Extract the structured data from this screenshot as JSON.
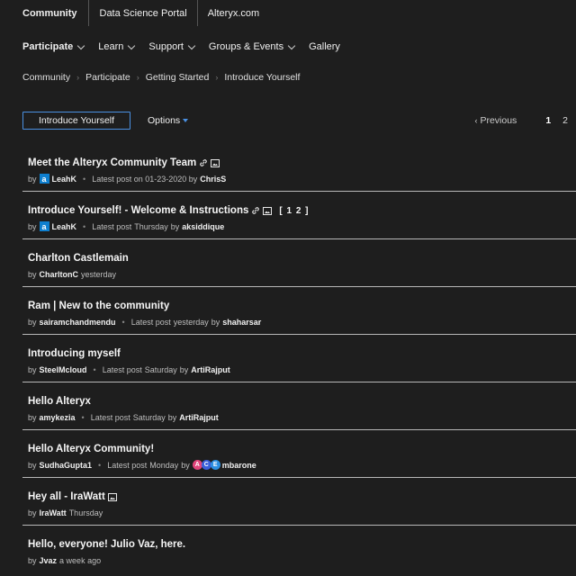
{
  "sites": [
    "Community",
    "Data Science Portal",
    "Alteryx.com"
  ],
  "nav": [
    "Participate",
    "Learn",
    "Support",
    "Groups & Events",
    "Gallery"
  ],
  "breadcrumb": [
    "Community",
    "Participate",
    "Getting Started",
    "Introduce Yourself"
  ],
  "toolbar": {
    "intro_button": "Introduce Yourself",
    "options": "Options"
  },
  "pager": {
    "previous": "Previous",
    "pages": [
      "1",
      "2"
    ],
    "current": "1"
  },
  "colors": {
    "accent": "#4a90e2",
    "background": "#1e1e1e",
    "divider": "#b8b8b8"
  },
  "topics": [
    {
      "title": "Meet the Alteryx Community Team",
      "by": "by",
      "author": "LeahK",
      "latest_prefix": "Latest post on 01-23-2020 by",
      "latest_user": "ChrisS",
      "icons": [
        "link-icon",
        "image-icon"
      ]
    },
    {
      "title": "Introduce Yourself! - Welcome & Instructions",
      "pages_ref": "[ 1 2 ]",
      "by": "by",
      "author": "LeahK",
      "latest_prefix": "Latest post",
      "latest_when": "Thursday",
      "latest_by": "by",
      "latest_user": "aksiddique",
      "icons": [
        "link-icon",
        "image-icon"
      ]
    },
    {
      "title": "Charlton Castlemain",
      "by": "by",
      "author": "CharltonC",
      "when": "yesterday"
    },
    {
      "title": "Ram | New to the community",
      "by": "by",
      "author": "sairamchandmendu",
      "latest_prefix": "Latest post",
      "latest_when": "yesterday",
      "latest_by": "by",
      "latest_user": "shaharsar"
    },
    {
      "title": "Introducing myself",
      "by": "by",
      "author": "SteelMcloud",
      "latest_prefix": "Latest post",
      "latest_when": "Saturday",
      "latest_by": "by",
      "latest_user": "ArtiRajput"
    },
    {
      "title": "Hello Alteryx",
      "by": "by",
      "author": "amykezia",
      "latest_prefix": "Latest post",
      "latest_when": "Saturday",
      "latest_by": "by",
      "latest_user": "ArtiRajput"
    },
    {
      "title": "Hello Alteryx Community!",
      "by": "by",
      "author": "SudhaGupta1",
      "latest_prefix": "Latest post",
      "latest_when": "Monday",
      "latest_by": "by",
      "latest_user": "mbarone",
      "ace_letters": [
        "A",
        "C",
        "E"
      ]
    },
    {
      "title": "Hey all - IraWatt",
      "by": "by",
      "author": "IraWatt",
      "when": "Thursday",
      "icons": [
        "image-icon"
      ]
    },
    {
      "title": "Hello, everyone! Julio Vaz, here.",
      "by": "by",
      "author": "Jvaz",
      "when": "a week ago"
    }
  ]
}
